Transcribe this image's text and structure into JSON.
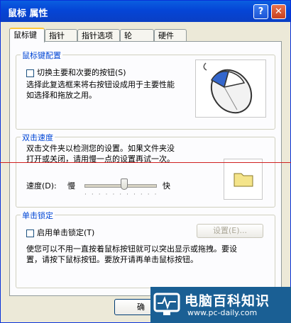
{
  "window": {
    "title": "鼠标 属性",
    "help_glyph": "?",
    "close_glyph": "✕"
  },
  "tabs": [
    "鼠标键",
    "指针",
    "指针选项",
    "轮",
    "硬件"
  ],
  "button_config": {
    "title": "鼠标键配置",
    "swap_label": "切换主要和次要的按钮(S)",
    "swap_checked": false,
    "desc_line1": "选择此复选框来将右按钮设成用于主要性能",
    "desc_line2": "如选择和拖放之用。"
  },
  "double_click": {
    "title": "双击速度",
    "desc_line1": "双击文件夹以检测您的设置。如果文件夹没",
    "desc_line2": "打开或关闭，请用慢一点的设置再试一次。",
    "speed_label": "速度(D):",
    "slow": "慢",
    "fast": "快",
    "speed_fraction": 0.55
  },
  "click_lock": {
    "title": "单击锁定",
    "enable_label": "启用单击锁定(T)",
    "enable_checked": false,
    "settings_button": "设置(E)...",
    "desc_line1": "使您可以不用一直按着鼠标按钮就可以突出显示或拖拽。要设",
    "desc_line2": "置，请按下鼠标按钮。要放开请再单击鼠标按钮。"
  },
  "footer": {
    "ok_label": "确"
  },
  "watermark": {
    "title": "电脑百科知识",
    "url": "www.pc-daily.com"
  },
  "colors": {
    "group_title": "#0046d5",
    "titlebar": "#0545d6",
    "close_button": "#c9401e",
    "folder": "#f4e48a"
  }
}
